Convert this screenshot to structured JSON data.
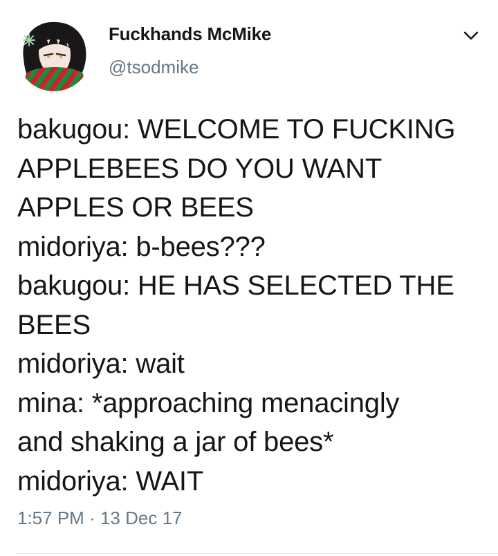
{
  "tweet": {
    "author": {
      "display_name": "Fuckhands McMike",
      "handle": "@tsodmike"
    },
    "lines": [
      "bakugou: WELCOME TO FUCKING",
      "APPLEBEES DO YOU WANT",
      "APPLES OR BEES",
      "midoriya: b-bees???",
      "bakugou: HE HAS SELECTED THE",
      "BEES",
      "midoriya: wait",
      "mina: *approaching menacingly",
      "and shaking a jar of bees*",
      "midoriya: WAIT"
    ],
    "time": "1:57 PM",
    "separator": "·",
    "date": "13 Dec 17"
  },
  "icons": {
    "menu": "chevron-down-icon",
    "avatar": "avatar"
  },
  "colors": {
    "text": "#14171a",
    "secondary": "#657786",
    "divider": "#e1e8ed"
  }
}
